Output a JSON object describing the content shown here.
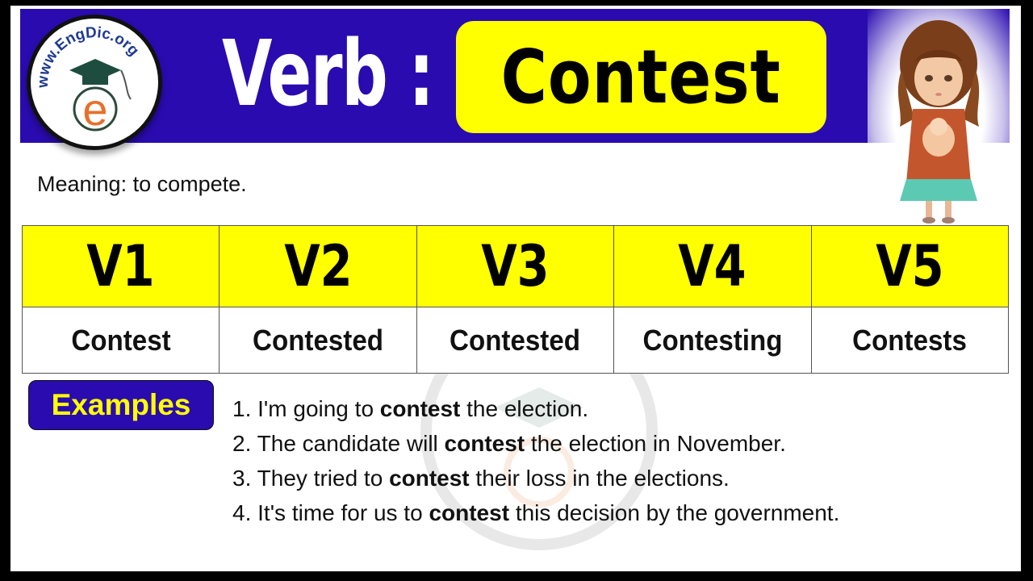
{
  "header": {
    "logo_text": "www.EngDic.org",
    "logo_letter": "e",
    "verb_label": "Verb :",
    "word": "Contest"
  },
  "meaning": "Meaning: to compete.",
  "forms_table": {
    "headers": [
      "V1",
      "V2",
      "V3",
      "V4",
      "V5"
    ],
    "values": [
      "Contest",
      "Contested",
      "Contested",
      "Contesting",
      "Contests"
    ]
  },
  "examples": {
    "label": "Examples",
    "items": [
      {
        "number": "1.",
        "before": "I'm going to",
        "keyword": "contest",
        "after": "the election."
      },
      {
        "number": "2.",
        "before": "The candidate will",
        "keyword": "contest",
        "after": "the election in November."
      },
      {
        "number": "3.",
        "before": "They tried to",
        "keyword": "contest",
        "after": "their loss in the elections."
      },
      {
        "number": "4.",
        "before": "It's time for us to",
        "keyword": "contest",
        "after": "this decision by the government."
      }
    ]
  },
  "colors": {
    "header_blue": "#2a0bb0",
    "highlight_yellow": "#ffff00",
    "logo_orange": "#e8702a",
    "logo_text_blue": "#1f3a93"
  }
}
